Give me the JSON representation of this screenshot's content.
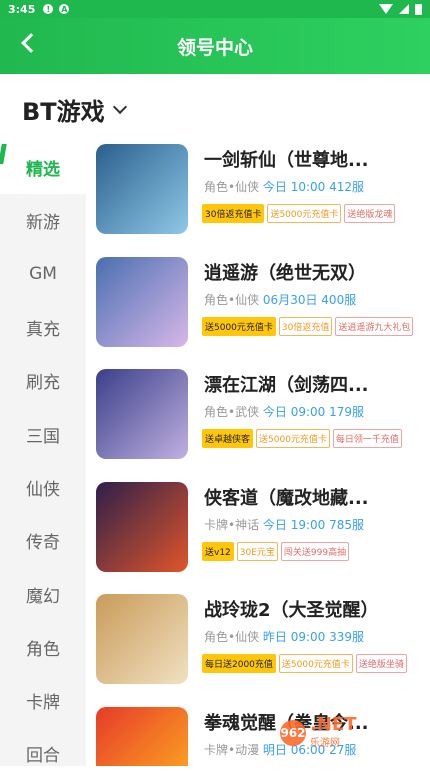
{
  "status": {
    "time": "3:45",
    "icon1": "!",
    "icon2": "A"
  },
  "header": {
    "title": "领号中心"
  },
  "section": {
    "title": "BT游戏"
  },
  "sidebar": {
    "items": [
      "精选",
      "新游",
      "GM",
      "真充",
      "刷充",
      "三国",
      "仙侠",
      "传奇",
      "魔幻",
      "角色",
      "卡牌",
      "回合"
    ],
    "active": 0
  },
  "games": [
    {
      "name": "一剑斩仙（世尊地...",
      "genre": "角色•仙侠",
      "time": "今日 10:00",
      "server": "412服",
      "tags": [
        "30倍返充值卡",
        "送5000元充值卡",
        "送绝版龙魂"
      ],
      "cover": [
        "#2a5f8c",
        "#8fc8e8"
      ]
    },
    {
      "name": "逍遥游（绝世无双）",
      "genre": "角色•仙侠",
      "time": "06月30日",
      "server": "400服",
      "tags": [
        "送5000元充值卡",
        "30倍返充值",
        "送逍遥游九大礼包"
      ],
      "cover": [
        "#4a6fb0",
        "#d7b7e9"
      ]
    },
    {
      "name": "漂在江湖（剑荡四...",
      "genre": "角色•武侠",
      "time": "今日 09:00",
      "server": "179服",
      "tags": [
        "送卓越侠客",
        "送5000元充值卡",
        "每日领一千充值"
      ],
      "cover": [
        "#3a3f8a",
        "#c0b0e0"
      ]
    },
    {
      "name": "侠客道（魔改地藏...",
      "genre": "卡牌•神话",
      "time": "今日 19:00",
      "server": "785服",
      "tags": [
        "送v12",
        "30E元宝",
        "闯关送999高抽"
      ],
      "cover": [
        "#2e1f4a",
        "#e0552a"
      ]
    },
    {
      "name": "战玲珑2（大圣觉醒）",
      "genre": "角色•仙侠",
      "time": "昨日 09:00",
      "server": "339服",
      "tags": [
        "每日送2000充值",
        "送5000元充值卡",
        "送绝版坐骑"
      ],
      "cover": [
        "#c99b5a",
        "#f0e0c0"
      ]
    },
    {
      "name": "拳魂觉醒（拳皇今...",
      "genre": "卡牌•动漫",
      "time": "明日 06:00",
      "server": "27服",
      "tags": [],
      "cover": [
        "#e63b2a",
        "#ffb020"
      ]
    }
  ],
  "watermark": {
    "logo": "962",
    "text": ".NET",
    "sub": "乐游网"
  }
}
